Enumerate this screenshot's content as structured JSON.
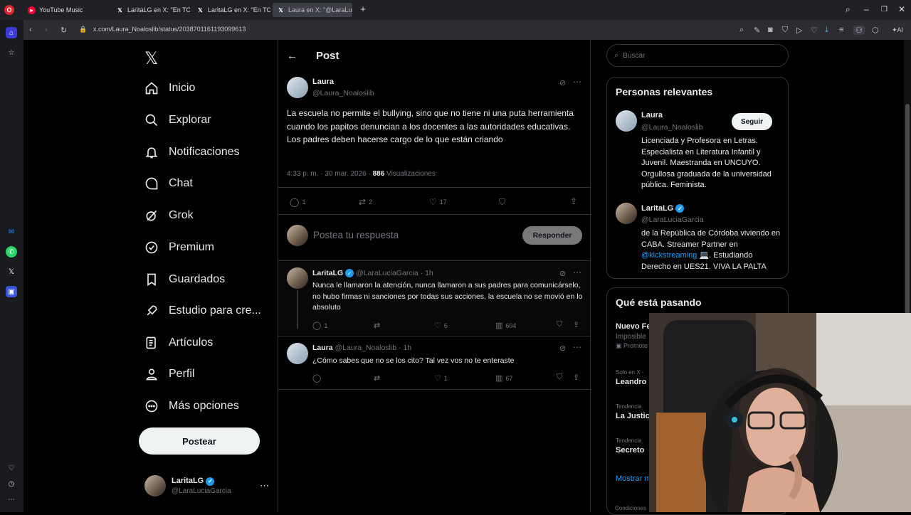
{
  "browser": {
    "tabs": [
      {
        "label": "YouTube Music",
        "icon": "youtube-music-icon",
        "active": false
      },
      {
        "label": "LaritaLG en X: \"En TODAS",
        "icon": "x-logo-icon",
        "active": false
      },
      {
        "label": "LaritaLG en X: \"En TODAS",
        "icon": "x-logo-icon",
        "active": false
      },
      {
        "label": "Laura en X: \"@LaraLuciaG",
        "icon": "x-logo-icon",
        "active": true
      }
    ],
    "url": "x.com/Laura_Noaloslib/status/2038701161193099613",
    "ai_label": "AI"
  },
  "nav": {
    "items": [
      {
        "label": "Inicio",
        "icon": "home-icon"
      },
      {
        "label": "Explorar",
        "icon": "search-icon"
      },
      {
        "label": "Notificaciones",
        "icon": "bell-icon"
      },
      {
        "label": "Chat",
        "icon": "chat-icon"
      },
      {
        "label": "Grok",
        "icon": "grok-icon"
      },
      {
        "label": "Premium",
        "icon": "premium-icon"
      },
      {
        "label": "Guardados",
        "icon": "bookmark-icon"
      },
      {
        "label": "Estudio para cre...",
        "icon": "rocket-icon"
      },
      {
        "label": "Artículos",
        "icon": "articles-icon"
      },
      {
        "label": "Perfil",
        "icon": "person-icon"
      },
      {
        "label": "Más opciones",
        "icon": "more-circle-icon"
      }
    ],
    "post_button": "Postear",
    "account": {
      "name": "LaritaLG",
      "handle": "@LaraLuciaGarcia"
    }
  },
  "header": {
    "title": "Post"
  },
  "main_post": {
    "name": "Laura",
    "handle": "@Laura_Noaloslib",
    "text": "La escuela no permite el bullying, sino que no tiene ni una puta herramienta cuando los papitos denuncian a los docentes a las autoridades educativas.  Los padres deben hacerse cargo de lo que están criando",
    "time": "4:33 p. m. · 30 mar. 2026 · ",
    "views": "886",
    "views_label": " Visualizaciones",
    "replies": "1",
    "reposts": "2",
    "likes": "17"
  },
  "reply_box": {
    "placeholder": "Postea tu respuesta",
    "button": "Responder"
  },
  "replies": [
    {
      "name": "LaritaLG",
      "handle": "@LaraLuciaGarcia · 1h",
      "text": "Nunca le llamaron la atención, nunca llamaron a sus padres para comunicárselo, no hubo firmas ni sanciones por todas sus acciones, la escuela no se movió en lo absoluto",
      "replies": "1",
      "reposts": "",
      "likes": "6",
      "views": "604"
    },
    {
      "name": "Laura",
      "handle": "@Laura_Noaloslib · 1h",
      "text": "¿Cómo sabes que no se los cito? Tal vez vos no te enteraste",
      "replies": "",
      "reposts": "",
      "likes": "1",
      "views": "67"
    }
  ],
  "sidebar": {
    "search_placeholder": "Buscar",
    "relevant": {
      "title": "Personas relevantes",
      "people": [
        {
          "name": "Laura",
          "handle": "@Laura_Noaloslib",
          "follow": "Seguir",
          "bio": "Licenciada y Profesora en Letras. Especialista en Literatura Infantil y Juvenil. Maestranda en UNCUYO. Orgullosa graduada de la universidad pública. Feminista."
        },
        {
          "name": "LaritaLG",
          "handle": "@LaraLuciaGarcia",
          "bio_pre": "de la República de Córdoba viviendo en CABA. Streamer Partner en ",
          "bio_link": "@kickstreaming",
          "bio_post": " 💻. Estudiando Derecho en UES21. VIVA LA PALTA"
        }
      ]
    },
    "trending": {
      "title": "Qué está pasando",
      "items": [
        {
          "top": "",
          "name": "Nuevo Fe",
          "sub": "Imposible",
          "promo": "Promote"
        },
        {
          "top": "Solo en X ·",
          "name": "Leandro I"
        },
        {
          "top": "Tendencia",
          "name": "La Justici"
        },
        {
          "top": "Tendencia",
          "name": "Secreto"
        }
      ],
      "show_more": "Mostrar m"
    },
    "footer": "Condiciones"
  },
  "colors": {
    "accent": "#1d9bf0",
    "background": "#000000",
    "border": "#2f3336",
    "muted": "#71767b"
  }
}
